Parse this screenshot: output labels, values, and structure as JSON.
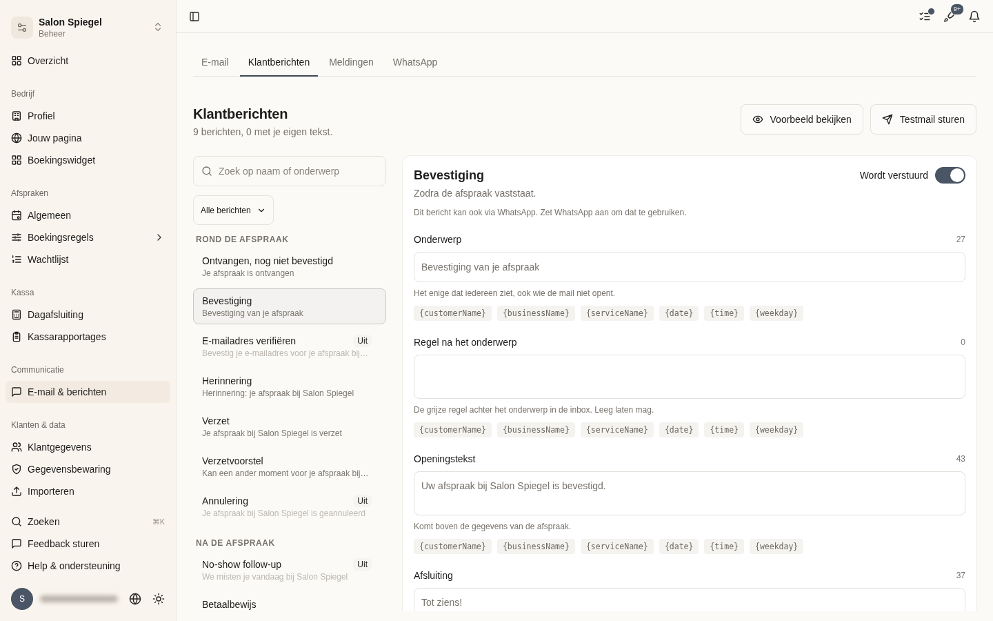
{
  "sidebar": {
    "workspace": {
      "name": "Salon Spiegel",
      "role": "Beheer"
    },
    "sections": [
      {
        "items": [
          {
            "label": "Overzicht",
            "selected": false
          }
        ]
      },
      {
        "label": "Bedrijf",
        "items": [
          {
            "label": "Profiel",
            "selected": false
          },
          {
            "label": "Jouw pagina",
            "selected": false
          },
          {
            "label": "Boekingswidget",
            "selected": false
          }
        ]
      },
      {
        "label": "Afspraken",
        "items": [
          {
            "label": "Algemeen",
            "selected": false
          },
          {
            "label": "Boekingsregels",
            "selected": false,
            "expanded": false
          },
          {
            "label": "Wachtlijst",
            "selected": false
          }
        ]
      },
      {
        "label": "Kassa",
        "items": [
          {
            "label": "Dagafsluiting",
            "selected": false
          },
          {
            "label": "Kassarapportages",
            "selected": false
          }
        ]
      },
      {
        "label": "Communicatie",
        "items": [
          {
            "label": "E-mail & berichten",
            "selected": true
          }
        ]
      },
      {
        "label": "Klanten & data",
        "items": [
          {
            "label": "Klantgegevens",
            "selected": false
          },
          {
            "label": "Gegevensbewaring",
            "selected": false
          },
          {
            "label": "Importeren",
            "selected": false
          }
        ]
      },
      {
        "items": [
          {
            "label": "Zoeken",
            "selected": false,
            "shortcut": "⌘K"
          },
          {
            "label": "Feedback sturen",
            "selected": false
          },
          {
            "label": "Help & ondersteuning",
            "selected": false
          }
        ]
      }
    ],
    "user": {
      "initial": "S"
    }
  },
  "topbar": {
    "badge": "9+"
  },
  "tabs": [
    {
      "label": "E-mail",
      "selected": false
    },
    {
      "label": "Klantberichten",
      "selected": true
    },
    {
      "label": "Meldingen",
      "selected": false
    },
    {
      "label": "WhatsApp",
      "selected": false
    }
  ],
  "page": {
    "title": "Klantberichten",
    "subtitle": "9 berichten, 0 met je eigen tekst.",
    "buttons": [
      "Voorbeeld bekijken",
      "Testmail sturen"
    ]
  },
  "list": {
    "search": {
      "placeholder": "Zoek op naam of onderwerp"
    },
    "filter": "Alle berichten",
    "groups": [
      {
        "label": "ROND DE AFSPRAAK",
        "items": [
          {
            "title": "Ontvangen, nog niet bevestigd",
            "subtitle": "Je afspraak is ontvangen",
            "selected": false,
            "enabled": true
          },
          {
            "title": "Bevestiging",
            "subtitle": "Bevestiging van je afspraak",
            "selected": true,
            "enabled": true
          },
          {
            "title": "E-mailadres verifiëren",
            "subtitle": "Bevestig je e-mailadres voor je afspraak bij…",
            "selected": false,
            "enabled": false,
            "badge": "Uit"
          },
          {
            "title": "Herinnering",
            "subtitle": "Herinnering: je afspraak bij Salon Spiegel",
            "selected": false,
            "enabled": true
          },
          {
            "title": "Verzet",
            "subtitle": "Je afspraak bij Salon Spiegel is verzet",
            "selected": false,
            "enabled": true
          },
          {
            "title": "Verzetvoorstel",
            "subtitle": "Kan een ander moment voor je afspraak bij…",
            "selected": false,
            "enabled": true
          },
          {
            "title": "Annulering",
            "subtitle": "Je afspraak bij Salon Spiegel is geannuleerd",
            "selected": false,
            "enabled": false,
            "badge": "Uit"
          }
        ]
      },
      {
        "label": "NA DE AFSPRAAK",
        "items": [
          {
            "title": "No-show follow-up",
            "subtitle": "We misten je vandaag bij Salon Spiegel",
            "selected": false,
            "enabled": false,
            "badge": "Uit"
          },
          {
            "title": "Betaalbewijs",
            "selected": false
          }
        ]
      }
    ]
  },
  "editor": {
    "title": "Bevestiging",
    "subtitle": "Zodra de afspraak vaststaat.",
    "note": "Dit bericht kan ook via WhatsApp. Zet WhatsApp aan om dat te gebruiken.",
    "toggle": {
      "label": "Wordt verstuurd",
      "on": true
    },
    "fields": [
      {
        "kind": "input",
        "label": "Onderwerp",
        "count": "27",
        "value": "Bevestiging van je afspraak",
        "hint": "Het enige dat iedereen ziet, ook wie de mail niet opent.",
        "variables": [
          "{customerName}",
          "{businessName}",
          "{serviceName}",
          "{date}",
          "{time}",
          "{weekday}"
        ]
      },
      {
        "kind": "textarea",
        "label": "Regel na het onderwerp",
        "count": "0",
        "hint": "De grijze regel achter het onderwerp in de inbox. Leeg laten mag.",
        "variables": [
          "{customerName}",
          "{businessName}",
          "{serviceName}",
          "{date}",
          "{time}",
          "{weekday}"
        ]
      },
      {
        "kind": "textarea",
        "label": "Openingstekst",
        "count": "43",
        "value": "Uw afspraak bij Salon Spiegel is bevestigd.",
        "hint": "Komt boven de gegevens van de afspraak.",
        "variables": [
          "{customerName}",
          "{businessName}",
          "{serviceName}",
          "{date}",
          "{time}",
          "{weekday}"
        ]
      },
      {
        "kind": "textarea",
        "label": "Afsluiting",
        "count": "37",
        "value": "Tot ziens!"
      }
    ]
  }
}
